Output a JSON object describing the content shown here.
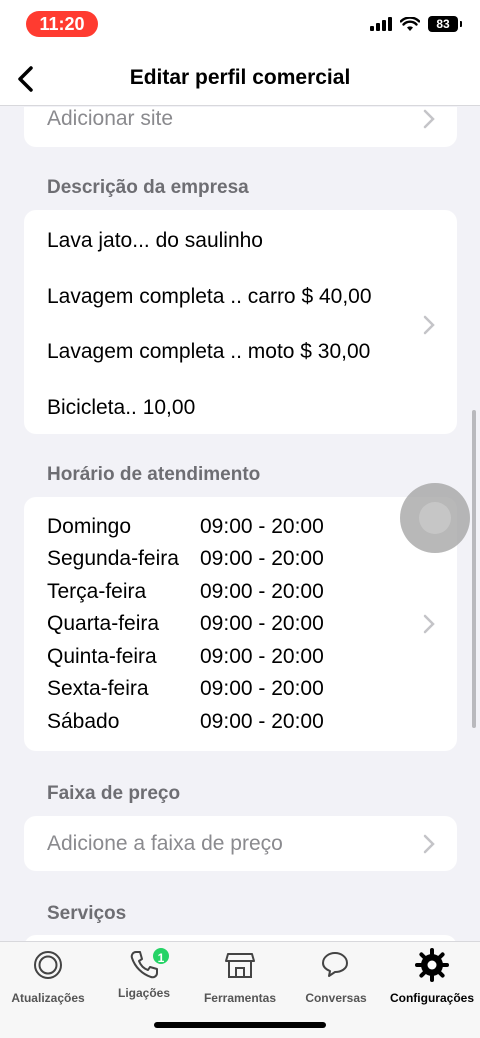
{
  "status_bar": {
    "time": "11:20",
    "battery": "83"
  },
  "nav": {
    "title": "Editar perfil comercial"
  },
  "website": {
    "label": "Adicionar site"
  },
  "description": {
    "section_title": "Descrição da empresa",
    "lines": [
      "Lava jato... do saulinho",
      "Lavagem completa .. carro $ 40,00",
      "Lavagem completa .. moto $ 30,00",
      "Bicicleta.. 10,00"
    ]
  },
  "hours": {
    "section_title": "Horário de atendimento",
    "rows": [
      {
        "day": "Domingo",
        "time": "09:00 - 20:00"
      },
      {
        "day": "Segunda-feira",
        "time": "09:00 - 20:00"
      },
      {
        "day": "Terça-feira",
        "time": "09:00 - 20:00"
      },
      {
        "day": "Quarta-feira",
        "time": "09:00 - 20:00"
      },
      {
        "day": "Quinta-feira",
        "time": "09:00 - 20:00"
      },
      {
        "day": "Sexta-feira",
        "time": "09:00 - 20:00"
      },
      {
        "day": "Sábado",
        "time": "09:00 - 20:00"
      }
    ]
  },
  "price_range": {
    "section_title": "Faixa de preço",
    "label": "Adicione a faixa de preço"
  },
  "services": {
    "section_title": "Serviços"
  },
  "tabs": [
    {
      "label": "Atualizações",
      "icon": "updates-icon"
    },
    {
      "label": "Ligações",
      "icon": "phone-icon",
      "badge": "1"
    },
    {
      "label": "Ferramentas",
      "icon": "store-icon"
    },
    {
      "label": "Conversas",
      "icon": "chat-icon"
    },
    {
      "label": "Configurações",
      "icon": "settings-icon",
      "active": true
    }
  ],
  "colors": {
    "badge": "#25d366",
    "time_pill": "#ff3b30"
  }
}
